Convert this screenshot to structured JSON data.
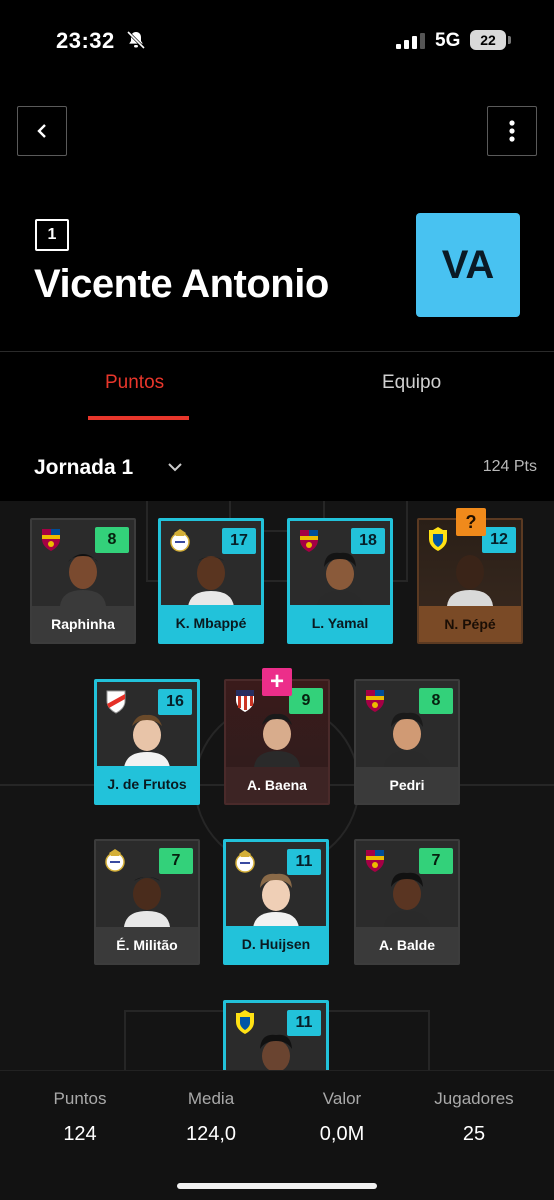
{
  "status_bar": {
    "time": "23:32",
    "network": "5G",
    "battery": "22"
  },
  "header": {
    "rank": "1",
    "name": "Vicente Antonio",
    "initials": "VA",
    "avatar_color": "#48c2f1"
  },
  "tabs": [
    {
      "label": "Puntos",
      "active": true
    },
    {
      "label": "Equipo",
      "active": false
    }
  ],
  "jornada": {
    "label": "Jornada 1",
    "total": "124 Pts"
  },
  "players": [
    {
      "name": "Raphinha",
      "points": "8",
      "style": "std",
      "club": "barcelona",
      "score_color": "green"
    },
    {
      "name": "K. Mbappé",
      "points": "17",
      "style": "cyan",
      "club": "real-madrid",
      "score_color": "cyan"
    },
    {
      "name": "L. Yamal",
      "points": "18",
      "style": "cyan",
      "club": "barcelona",
      "score_color": "cyan"
    },
    {
      "name": "N. Pépé",
      "points": "12",
      "style": "orange",
      "club": "villarreal",
      "score_color": "cyan",
      "badge": "?"
    },
    {
      "name": "J. de Frutos",
      "points": "16",
      "style": "cyan",
      "club": "rayo-vallecano",
      "score_color": "cyan"
    },
    {
      "name": "A. Baena",
      "points": "9",
      "style": "red",
      "club": "atletico-madrid",
      "score_color": "green",
      "badge": "+"
    },
    {
      "name": "Pedri",
      "points": "8",
      "style": "std",
      "club": "barcelona",
      "score_color": "green"
    },
    {
      "name": "É. Militão",
      "points": "7",
      "style": "std",
      "club": "real-madrid",
      "score_color": "green"
    },
    {
      "name": "D. Huijsen",
      "points": "11",
      "style": "cyan",
      "club": "real-madrid",
      "score_color": "cyan"
    },
    {
      "name": "A. Balde",
      "points": "7",
      "style": "std",
      "club": "barcelona",
      "score_color": "green"
    },
    {
      "name": "",
      "points": "11",
      "style": "cyan",
      "club": "villarreal",
      "score_color": "cyan"
    }
  ],
  "stats": [
    {
      "label": "Puntos",
      "value": "124"
    },
    {
      "label": "Media",
      "value": "124,0"
    },
    {
      "label": "Valor",
      "value": "0,0M"
    },
    {
      "label": "Jugadores",
      "value": "25"
    }
  ]
}
